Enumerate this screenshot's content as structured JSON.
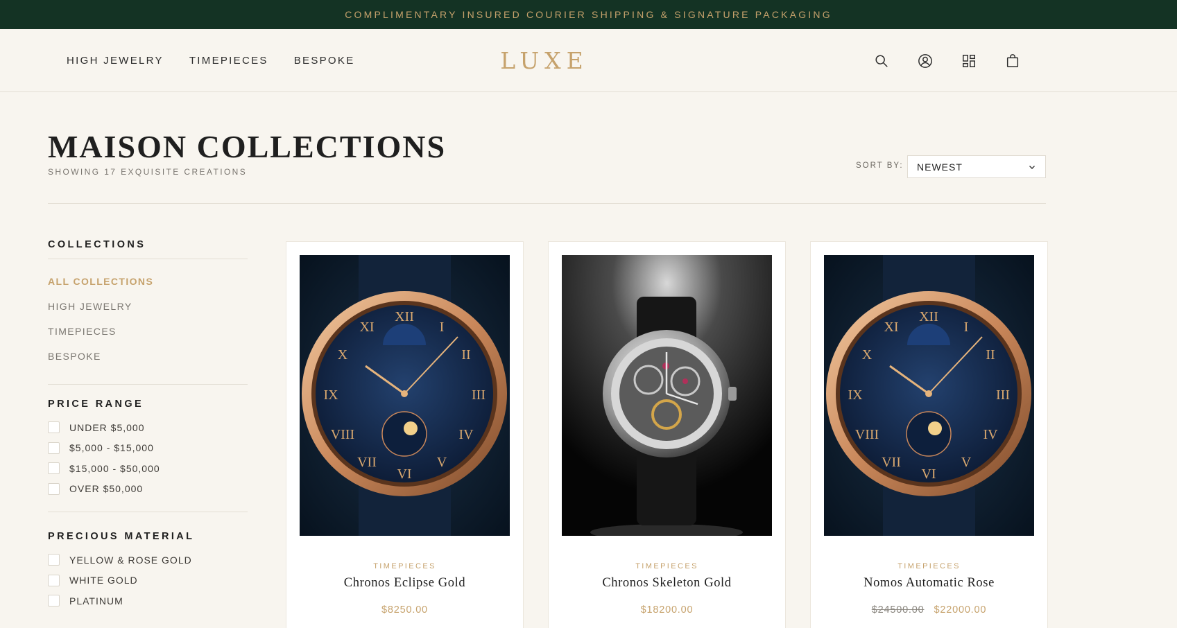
{
  "announcement": "COMPLIMENTARY INSURED COURIER SHIPPING & SIGNATURE PACKAGING",
  "nav": {
    "items": [
      "HIGH JEWELRY",
      "TIMEPIECES",
      "BESPOKE"
    ]
  },
  "brand": "LUXE",
  "icons": {
    "search": "search-icon",
    "account": "account-icon",
    "collections": "grid-icon",
    "bag": "bag-icon"
  },
  "page": {
    "title": "MAISON COLLECTIONS",
    "subtitle": "SHOWING 17 EXQUISITE CREATIONS"
  },
  "sort": {
    "label": "SORT BY:",
    "value": "NEWEST"
  },
  "sidebar": {
    "collections": {
      "heading": "COLLECTIONS",
      "items": [
        "ALL COLLECTIONS",
        "HIGH JEWELRY",
        "TIMEPIECES",
        "BESPOKE"
      ],
      "active": "ALL COLLECTIONS"
    },
    "price": {
      "heading": "PRICE RANGE",
      "options": [
        "UNDER $5,000",
        "$5,000 - $15,000",
        "$15,000 - $50,000",
        "OVER $50,000"
      ]
    },
    "material": {
      "heading": "PRECIOUS MATERIAL",
      "options": [
        "YELLOW & ROSE GOLD",
        "WHITE GOLD",
        "PLATINUM"
      ]
    }
  },
  "products": [
    {
      "category": "TIMEPIECES",
      "name": "Chronos Eclipse Gold",
      "price": "$8250.00",
      "old_price": ""
    },
    {
      "category": "TIMEPIECES",
      "name": "Chronos Skeleton Gold",
      "price": "$18200.00",
      "old_price": ""
    },
    {
      "category": "TIMEPIECES",
      "name": "Nomos Automatic Rose",
      "price": "$22000.00",
      "old_price": "$24500.00"
    }
  ],
  "colors": {
    "accent": "#c6a26c",
    "banner": "#143324",
    "background": "#f8f5ef"
  }
}
